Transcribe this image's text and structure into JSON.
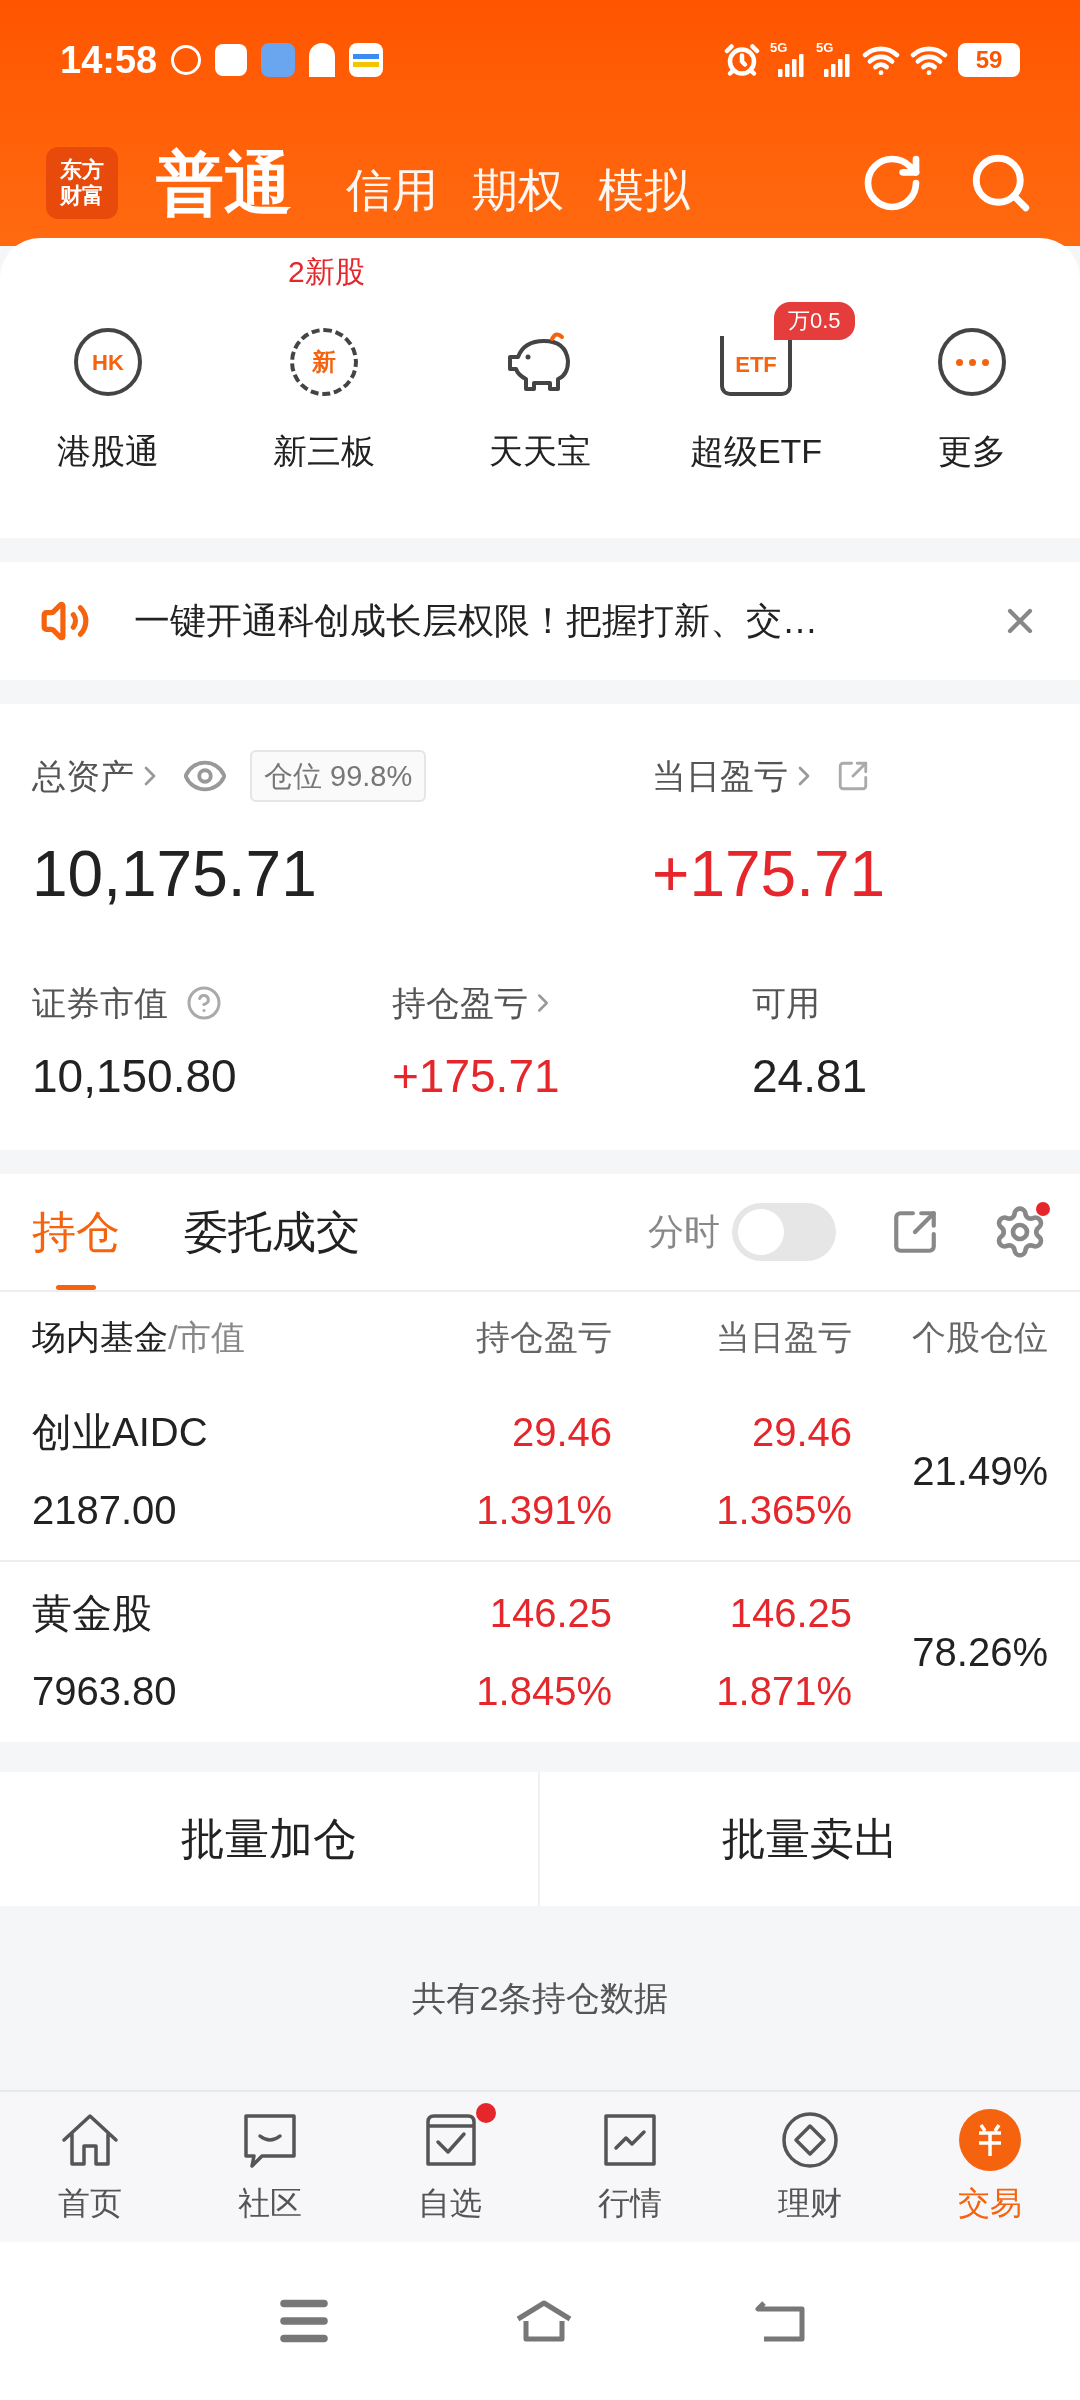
{
  "status_bar": {
    "time": "14:58",
    "battery": "59",
    "network": [
      "5G",
      "5G"
    ]
  },
  "header": {
    "logo_lines": [
      "东方",
      "财富"
    ],
    "account_tabs": [
      {
        "label": "普通",
        "selected": true
      },
      {
        "label": "信用",
        "selected": false
      },
      {
        "label": "期权",
        "selected": false
      },
      {
        "label": "模拟",
        "selected": false
      }
    ]
  },
  "promo_row": {
    "badge": "2新股"
  },
  "services": [
    {
      "kind": "hk",
      "icon_text": "HK",
      "label": "港股通"
    },
    {
      "kind": "new",
      "icon_text": "新",
      "label": "新三板"
    },
    {
      "kind": "piggy",
      "label": "天天宝"
    },
    {
      "kind": "etf",
      "icon_text": "ETF",
      "tag": "万0.5",
      "label": "超级ETF"
    },
    {
      "kind": "more",
      "label": "更多"
    }
  ],
  "notice": {
    "text": "一键开通科创成长层权限！把握打新、交…"
  },
  "assets": {
    "total_label": "总资产",
    "position_tag": "仓位 99.8%",
    "total_value": "10,175.71",
    "daily_label": "当日盈亏",
    "daily_value": "+175.71",
    "stats": [
      {
        "kind": "help",
        "label": "证券市值",
        "value": "10,150.80",
        "up": false
      },
      {
        "kind": "link",
        "label": "持仓盈亏",
        "value": "+175.71",
        "up": true
      },
      {
        "kind": "plain",
        "label": "可用",
        "value": "24.81",
        "up": false
      }
    ]
  },
  "holdings": {
    "tabs": [
      {
        "label": "持仓",
        "selected": true
      },
      {
        "label": "委托成交",
        "selected": false
      }
    ],
    "toggle": {
      "label": "分时",
      "on": false
    },
    "settings_dot": true,
    "columns": [
      {
        "label": "场内基金",
        "suffix": "/市值"
      },
      {
        "label": "持仓盈亏"
      },
      {
        "label": "当日盈亏"
      },
      {
        "label": "个股仓位"
      }
    ],
    "rows": [
      {
        "name": "创业AIDC",
        "value": "2187.00",
        "pnl": "29.46",
        "pnl_pct": "1.391%",
        "day": "29.46",
        "day_pct": "1.365%",
        "weight": "21.49%"
      },
      {
        "name": "黄金股",
        "value": "7963.80",
        "pnl": "146.25",
        "pnl_pct": "1.845%",
        "day": "146.25",
        "day_pct": "1.871%",
        "weight": "78.26%"
      }
    ]
  },
  "actions": [
    "批量加仓",
    "批量卖出"
  ],
  "summary": "共有2条持仓数据",
  "nav": [
    {
      "kind": "home",
      "label": "首页",
      "selected": false,
      "dot": false
    },
    {
      "kind": "community",
      "label": "社区",
      "selected": false,
      "dot": false
    },
    {
      "kind": "watch",
      "label": "自选",
      "selected": false,
      "dot": true
    },
    {
      "kind": "market",
      "label": "行情",
      "selected": false,
      "dot": false
    },
    {
      "kind": "wealth",
      "label": "理财",
      "selected": false,
      "dot": false
    },
    {
      "kind": "trade",
      "label": "交易",
      "selected": true,
      "dot": false
    }
  ]
}
